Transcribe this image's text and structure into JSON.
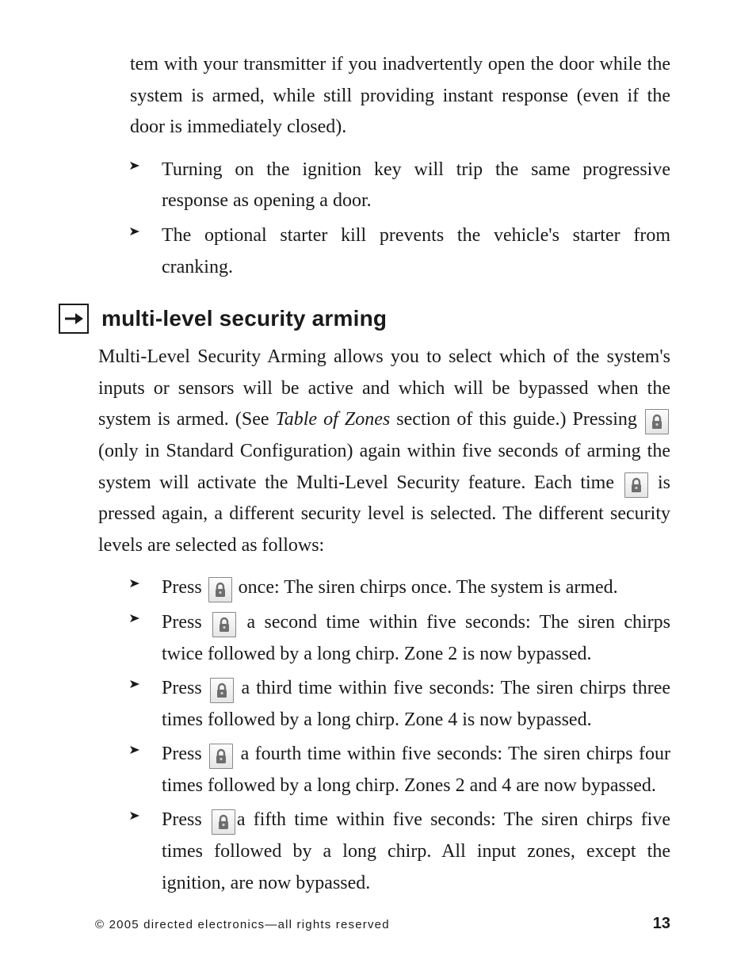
{
  "continuation": {
    "para": "tem with your transmitter if you inadvertently open the door while the system is armed, while still providing instant response (even if the door is immediately closed).",
    "bullets": [
      "Turning on the ignition key will trip the same progressive response as opening a door.",
      "The optional starter kill prevents the vehicle's starter from cranking."
    ]
  },
  "section": {
    "title": "multi-level security arming",
    "intro_parts": {
      "a": "Multi-Level Security Arming allows you to select which of the system's inputs or sensors will be active and which will be bypassed when the system is armed. (See ",
      "b_italic": "Table of Zones",
      "c": " section of this guide.) Pressing ",
      "d": " (only in Standard Configuration) again within five seconds of arming the system will activate the Multi-Level Security feature. Each time ",
      "e": " is pressed again, a different security level is selected. The different security levels are selected as follows:"
    },
    "steps": [
      {
        "pre": "Press ",
        "post": " once: The siren chirps once. The system is armed."
      },
      {
        "pre": "Press ",
        "post": " a second time within five seconds: The siren chirps twice followed by a long chirp. Zone 2 is now bypassed."
      },
      {
        "pre": "Press ",
        "post": " a third time within five seconds: The siren chirps three times followed by a long chirp. Zone 4 is now bypassed."
      },
      {
        "pre": "Press ",
        "post": " a fourth time within five seconds: The siren chirps four times followed by a long chirp. Zones 2 and 4 are now bypassed."
      },
      {
        "pre": "Press ",
        "post": "a fifth time within five seconds: The siren chirps five times followed by a long chirp. All input zones, except the ignition, are now bypassed."
      }
    ]
  },
  "footer": {
    "copyright": "© 2005 directed electronics—all rights reserved",
    "page_number": "13"
  },
  "icons": {
    "lock_label": "lock button"
  }
}
